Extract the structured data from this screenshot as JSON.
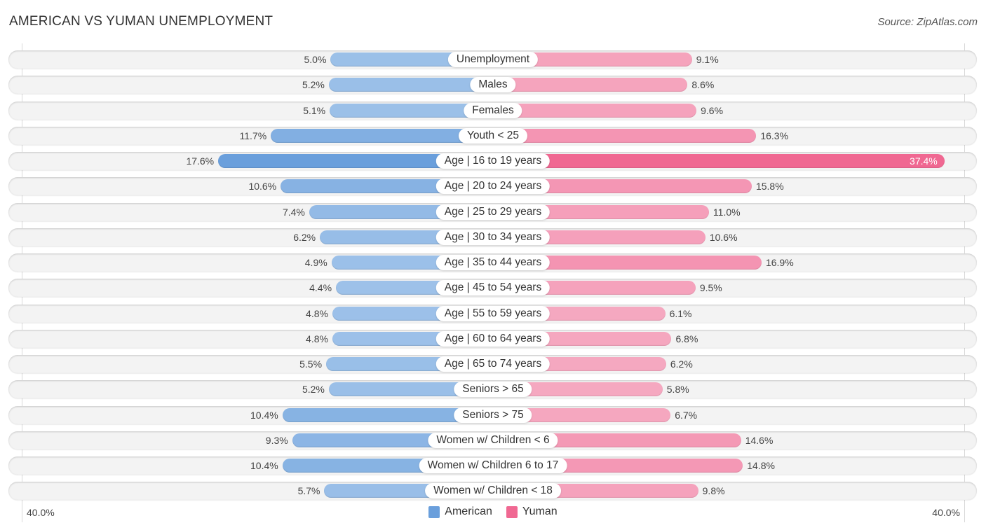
{
  "chart_data": {
    "type": "bar",
    "orientation": "horizontal-diverging",
    "title": "AMERICAN VS YUMAN UNEMPLOYMENT",
    "source": "Source: ZipAtlas.com",
    "axis": {
      "left_label": "40.0%",
      "right_label": "40.0%",
      "max": 40.0
    },
    "legend": [
      {
        "name": "American",
        "color": "#6a9fdc"
      },
      {
        "name": "Yuman",
        "color": "#f06892"
      }
    ],
    "categories": [
      "Unemployment",
      "Males",
      "Females",
      "Youth < 25",
      "Age | 16 to 19 years",
      "Age | 20 to 24 years",
      "Age | 25 to 29 years",
      "Age | 30 to 34 years",
      "Age | 35 to 44 years",
      "Age | 45 to 54 years",
      "Age | 55 to 59 years",
      "Age | 60 to 64 years",
      "Age | 65 to 74 years",
      "Seniors > 65",
      "Seniors > 75",
      "Women w/ Children < 6",
      "Women w/ Children 6 to 17",
      "Women w/ Children < 18"
    ],
    "series": [
      {
        "name": "American",
        "values": [
          5.0,
          5.2,
          5.1,
          11.7,
          17.6,
          10.6,
          7.4,
          6.2,
          4.9,
          4.4,
          4.8,
          4.8,
          5.5,
          5.2,
          10.4,
          9.3,
          10.4,
          5.7
        ]
      },
      {
        "name": "Yuman",
        "values": [
          9.1,
          8.6,
          9.6,
          16.3,
          37.4,
          15.8,
          11.0,
          10.6,
          16.9,
          9.5,
          6.1,
          6.8,
          6.2,
          5.8,
          6.7,
          14.6,
          14.8,
          9.8
        ]
      }
    ],
    "value_labels": {
      "American": [
        "5.0%",
        "5.2%",
        "5.1%",
        "11.7%",
        "17.6%",
        "10.6%",
        "7.4%",
        "6.2%",
        "4.9%",
        "4.4%",
        "4.8%",
        "4.8%",
        "5.5%",
        "5.2%",
        "10.4%",
        "9.3%",
        "10.4%",
        "5.7%"
      ],
      "Yuman": [
        "9.1%",
        "8.6%",
        "9.6%",
        "16.3%",
        "37.4%",
        "15.8%",
        "11.0%",
        "10.6%",
        "16.9%",
        "9.5%",
        "6.1%",
        "6.8%",
        "6.2%",
        "5.8%",
        "6.7%",
        "14.6%",
        "14.8%",
        "9.8%"
      ]
    }
  }
}
